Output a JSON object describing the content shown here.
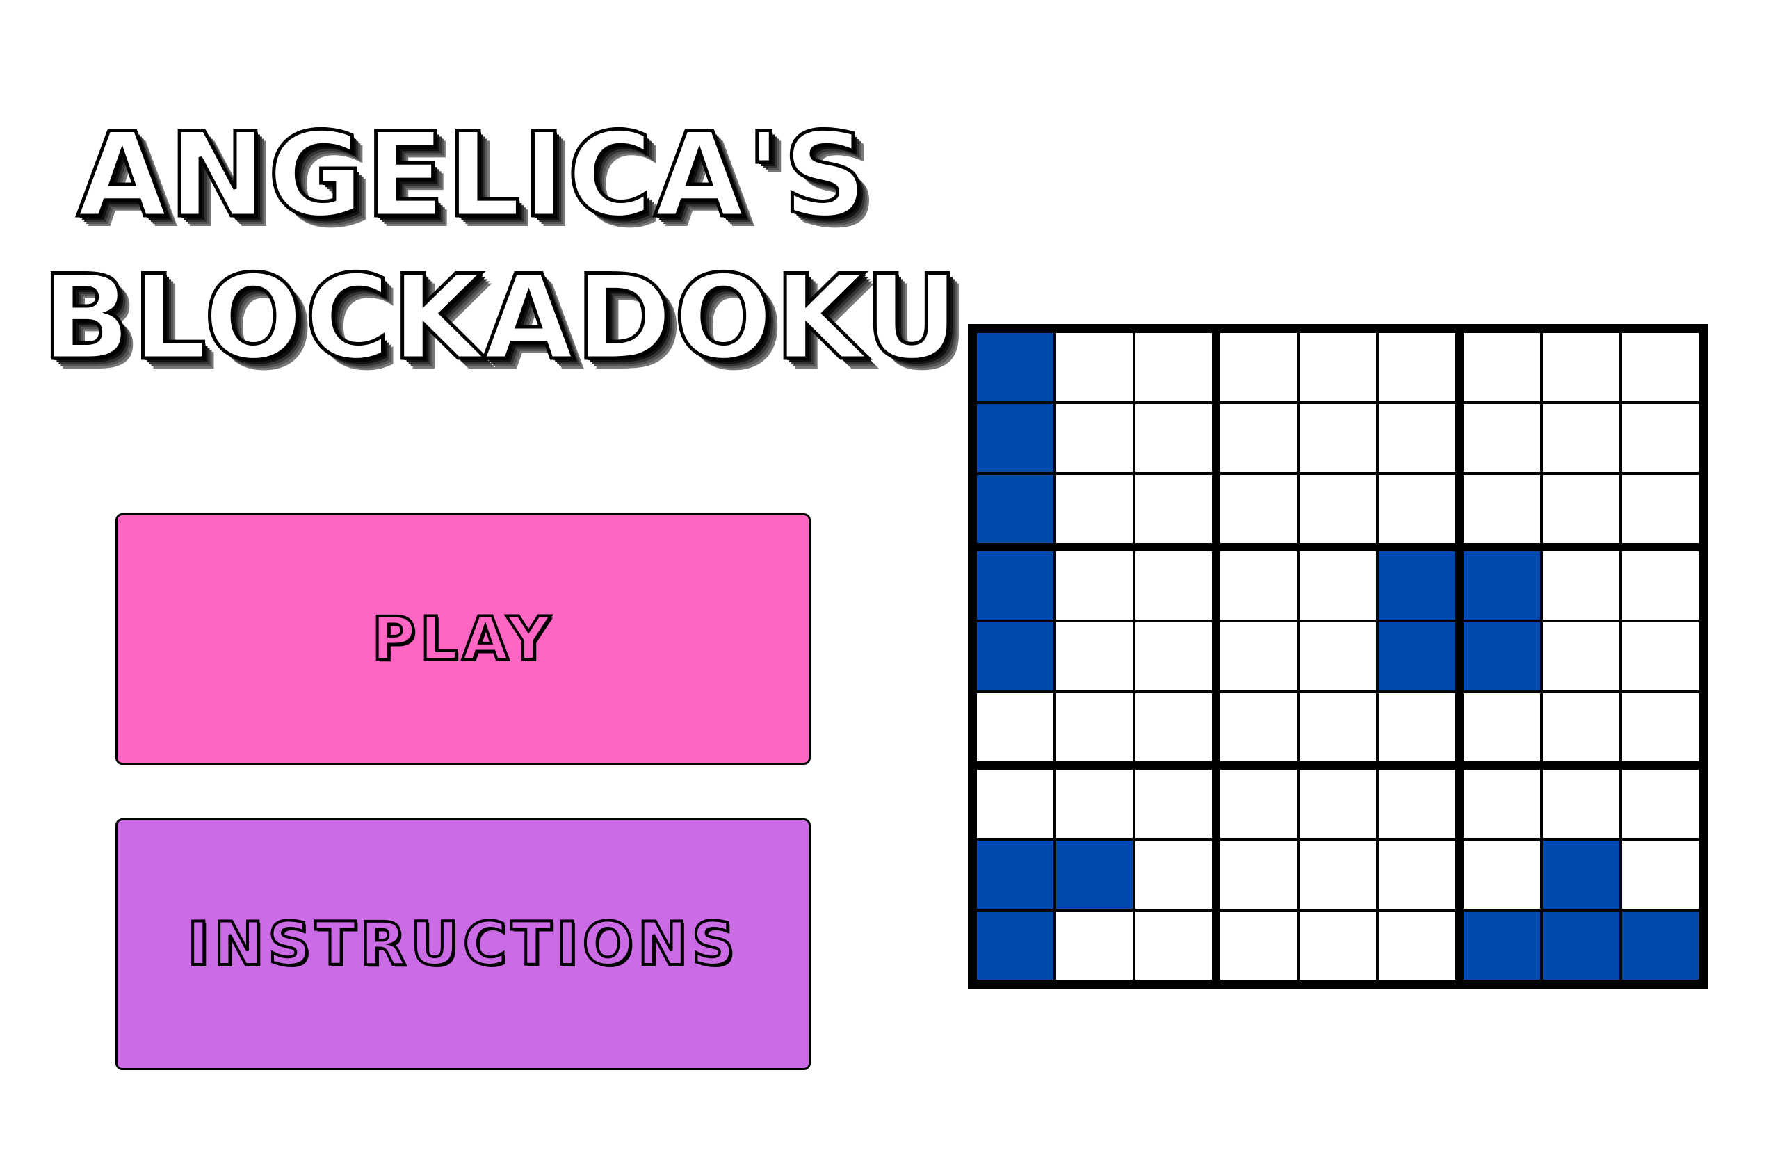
{
  "title": {
    "line1": "ANGELICA'S",
    "line2": "BLOCKADOKU"
  },
  "buttons": {
    "play": {
      "label": "PLAY",
      "color": "#ff66c4",
      "text_color": "#ff66c4"
    },
    "instructions": {
      "label": "INSTRUCTIONS",
      "color": "#cb6ce6",
      "text_color": "#cb6ce6"
    }
  },
  "board": {
    "size": 9,
    "filled_color": "#004aad",
    "empty_color": "#ffffff",
    "grid": [
      [
        1,
        0,
        0,
        0,
        0,
        0,
        0,
        0,
        0
      ],
      [
        1,
        0,
        0,
        0,
        0,
        0,
        0,
        0,
        0
      ],
      [
        1,
        0,
        0,
        0,
        0,
        0,
        0,
        0,
        0
      ],
      [
        1,
        0,
        0,
        0,
        0,
        1,
        1,
        0,
        0
      ],
      [
        1,
        0,
        0,
        0,
        0,
        1,
        1,
        0,
        0
      ],
      [
        0,
        0,
        0,
        0,
        0,
        0,
        0,
        0,
        0
      ],
      [
        0,
        0,
        0,
        0,
        0,
        0,
        0,
        0,
        0
      ],
      [
        1,
        1,
        0,
        0,
        0,
        0,
        0,
        1,
        0
      ],
      [
        1,
        0,
        0,
        0,
        0,
        0,
        1,
        1,
        1
      ]
    ]
  }
}
